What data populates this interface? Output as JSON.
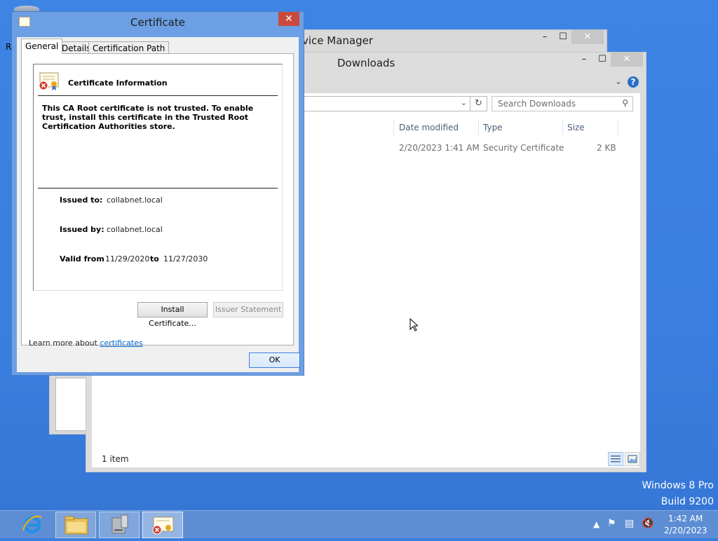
{
  "desktop": {
    "partial_letter": "R",
    "watermark_line1": "Windows 8 Pro",
    "watermark_line2": "Build 9200"
  },
  "device_manager": {
    "title_partial": "vice Manager"
  },
  "explorer": {
    "title": "Downloads",
    "search_placeholder": "Search Downloads",
    "columns": [
      "Date modified",
      "Type",
      "Size"
    ],
    "rows": [
      {
        "date_modified": "2/20/2023 1:41 AM",
        "type": "Security Certificate",
        "size": "2 KB"
      }
    ],
    "status_count": "1 item"
  },
  "certificate": {
    "title": "Certificate",
    "tabs": [
      "General",
      "Details",
      "Certification Path"
    ],
    "heading": "Certificate Information",
    "warning": "This CA Root certificate is not trusted. To enable trust, install this certificate in the Trusted Root Certification Authorities store.",
    "issued_to_label": "Issued to:",
    "issued_to_value": "collabnet.local",
    "issued_by_label": "Issued by:",
    "issued_by_value": "collabnet.local",
    "valid_from_label": "Valid from",
    "valid_from_value": "11/29/2020",
    "valid_to_label": "to",
    "valid_to_value": "11/27/2030",
    "install_button": "Install Certificate...",
    "issuer_statement_button": "Issuer Statement",
    "learn_more_prefix": "Learn more about ",
    "learn_more_link": "certificates",
    "ok_button": "OK"
  },
  "taskbar": {
    "items": [
      "internet-explorer",
      "file-explorer",
      "device-manager",
      "certificate"
    ],
    "clock_time": "1:42 AM",
    "clock_date": "2/20/2023"
  },
  "colors": {
    "desktop_bg": "#3a7fe0",
    "link": "#0066cc",
    "close_red": "#c94a3c"
  }
}
